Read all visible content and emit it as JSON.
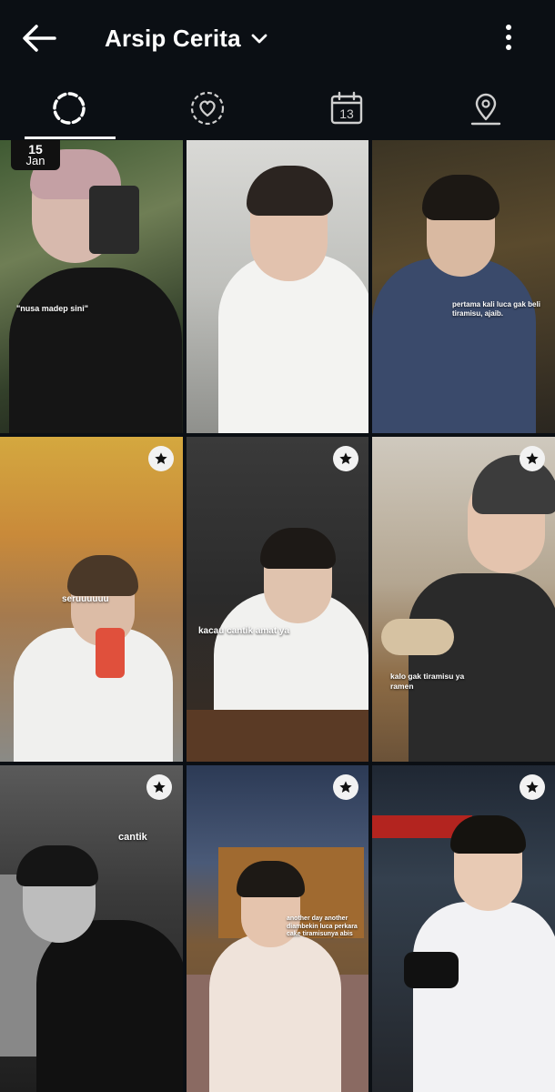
{
  "header": {
    "title": "Arsip Cerita",
    "back_icon": "arrow-left-icon",
    "dropdown_icon": "chevron-down-icon",
    "more_icon": "more-vertical-icon"
  },
  "tabs": [
    {
      "icon": "story-circle-icon",
      "active": true
    },
    {
      "icon": "heart-circle-icon",
      "active": false
    },
    {
      "icon": "calendar-icon",
      "label": "13",
      "active": false
    },
    {
      "icon": "location-pin-icon",
      "active": false
    }
  ],
  "stories": [
    {
      "caption": "\"nusa madep sini\"",
      "date_day": "15",
      "date_month": "Jan",
      "starred": false
    },
    {
      "caption": "",
      "starred": false
    },
    {
      "caption": "pertama kali luca gak beli tiramisu, ajaib.",
      "starred": false
    },
    {
      "caption": "seruuuuuu",
      "starred": false
    },
    {
      "caption": "kacau cantik amat ya",
      "starred": true
    },
    {
      "caption": "kalo gak tiramisu ya ramen",
      "starred": true
    },
    {
      "caption": "cantik",
      "starred": true
    },
    {
      "caption": "another day another diambekin luca perkara cake tiramisunya abis",
      "starred": true
    },
    {
      "caption": "",
      "starred": true
    }
  ],
  "colors": {
    "background": "#0b0f14",
    "icon": "#ffffff",
    "star_badge": "#f2f2f2"
  }
}
